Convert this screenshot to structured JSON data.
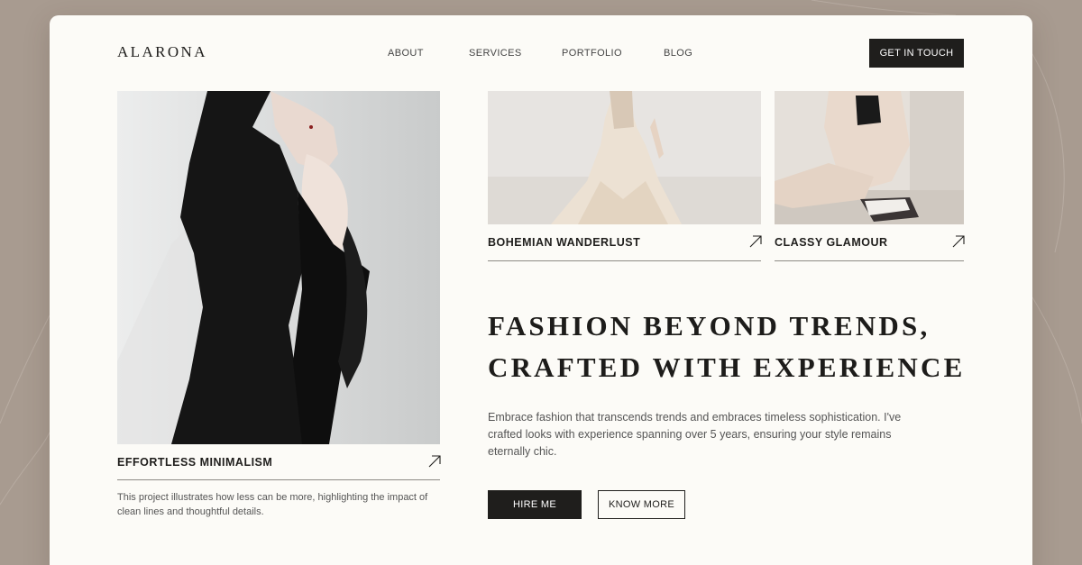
{
  "brand": {
    "logo": "ALARONA"
  },
  "nav": {
    "items": [
      "ABOUT",
      "SERVICES",
      "PORTFOLIO",
      "BLOG"
    ],
    "cta": "GET IN TOUCH"
  },
  "projects": [
    {
      "title": "EFFORTLESS MINIMALISM",
      "description": "This project illustrates how less can be more, highlighting the impact of clean lines and thoughtful details.",
      "icon": "arrow-up-right-icon"
    },
    {
      "title": "BOHEMIAN WANDERLUST",
      "icon": "arrow-up-right-icon"
    },
    {
      "title": "CLASSY GLAMOUR",
      "icon": "arrow-up-right-icon"
    }
  ],
  "hero": {
    "headline_line1": "FASHION BEYOND TRENDS,",
    "headline_line2": "CRAFTED WITH EXPERIENCE",
    "body": "Embrace fashion that transcends trends and embraces timeless sophistication. I've crafted looks with experience spanning over 5 years, ensuring your style remains eternally chic.",
    "primary_button": "HIRE ME",
    "secondary_button": "KNOW MORE"
  },
  "colors": {
    "background": "#a89b90",
    "card": "#fcfbf7",
    "ink": "#1f1e1c",
    "muted": "#555555"
  }
}
